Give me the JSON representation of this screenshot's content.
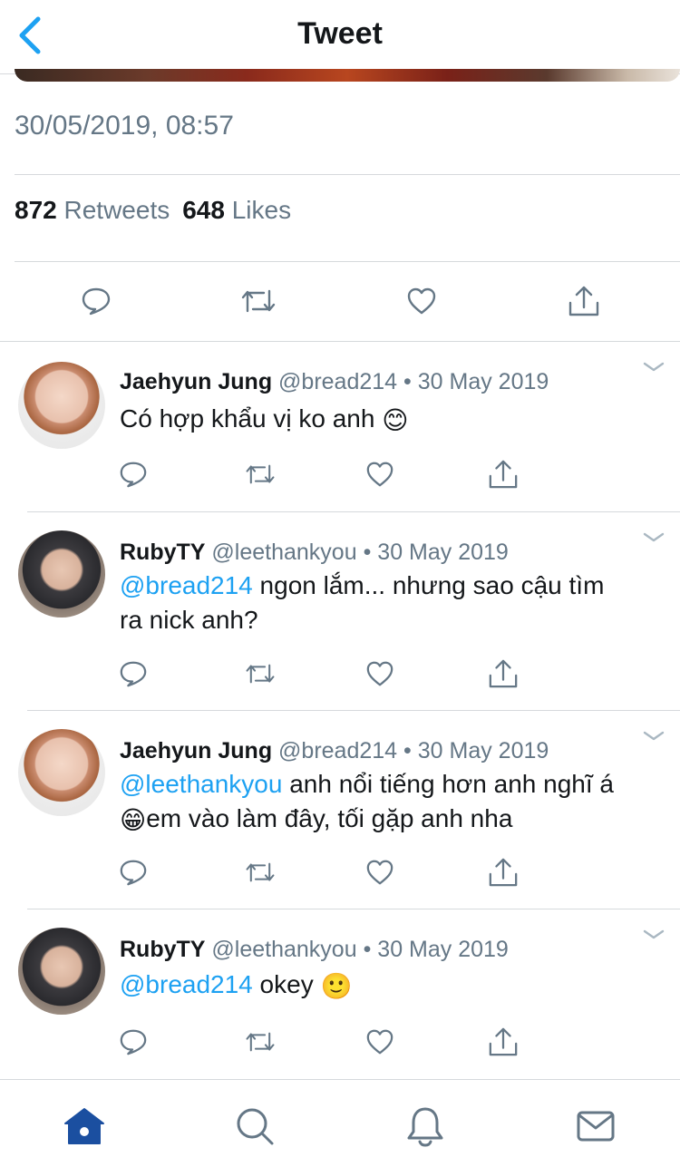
{
  "header": {
    "title": "Tweet",
    "back_icon": "chevron-left-icon"
  },
  "tweet": {
    "timestamp": "30/05/2019, 08:57",
    "retweets_count": "872",
    "retweets_label": "Retweets",
    "likes_count": "648",
    "likes_label": "Likes",
    "actions": [
      "reply-icon",
      "retweet-icon",
      "like-icon",
      "share-icon"
    ]
  },
  "replies": [
    {
      "name": "Jaehyun Jung",
      "handle": "@bread214",
      "sep": "•",
      "date": "30 May 2019",
      "mention": "",
      "line1": "Có hợp khẩu vị ko anh",
      "emoji1": "😊",
      "line2": "",
      "emoji2": ""
    },
    {
      "name": "RubyTY",
      "handle": "@leethankyou",
      "sep": "•",
      "date": "30 May 2019",
      "mention": "@bread214",
      "line1": " ngon lắm... nhưng sao cậu tìm",
      "emoji1": "",
      "line2": "ra nick anh?",
      "emoji2": ""
    },
    {
      "name": "Jaehyun Jung",
      "handle": "@bread214",
      "sep": "•",
      "date": "30 May 2019",
      "mention": "@leethankyou",
      "line1": " anh nổi tiếng hơn anh nghĩ á",
      "emoji1": "😁",
      "line2": "em vào làm đây, tối gặp anh nha",
      "emoji2": ""
    },
    {
      "name": "RubyTY",
      "handle": "@leethankyou",
      "sep": "•",
      "date": "30 May 2019",
      "mention": "@bread214",
      "line1": " okey",
      "emoji1": "🙂",
      "line2": "",
      "emoji2": ""
    }
  ],
  "tabbar": {
    "items": [
      "home-icon",
      "search-icon",
      "notifications-icon",
      "messages-icon"
    ],
    "active_color": "#1b4fa0"
  },
  "colors": {
    "accent": "#1da1f2",
    "muted": "#657786",
    "text": "#14171a",
    "divider": "#d6d9dc"
  }
}
